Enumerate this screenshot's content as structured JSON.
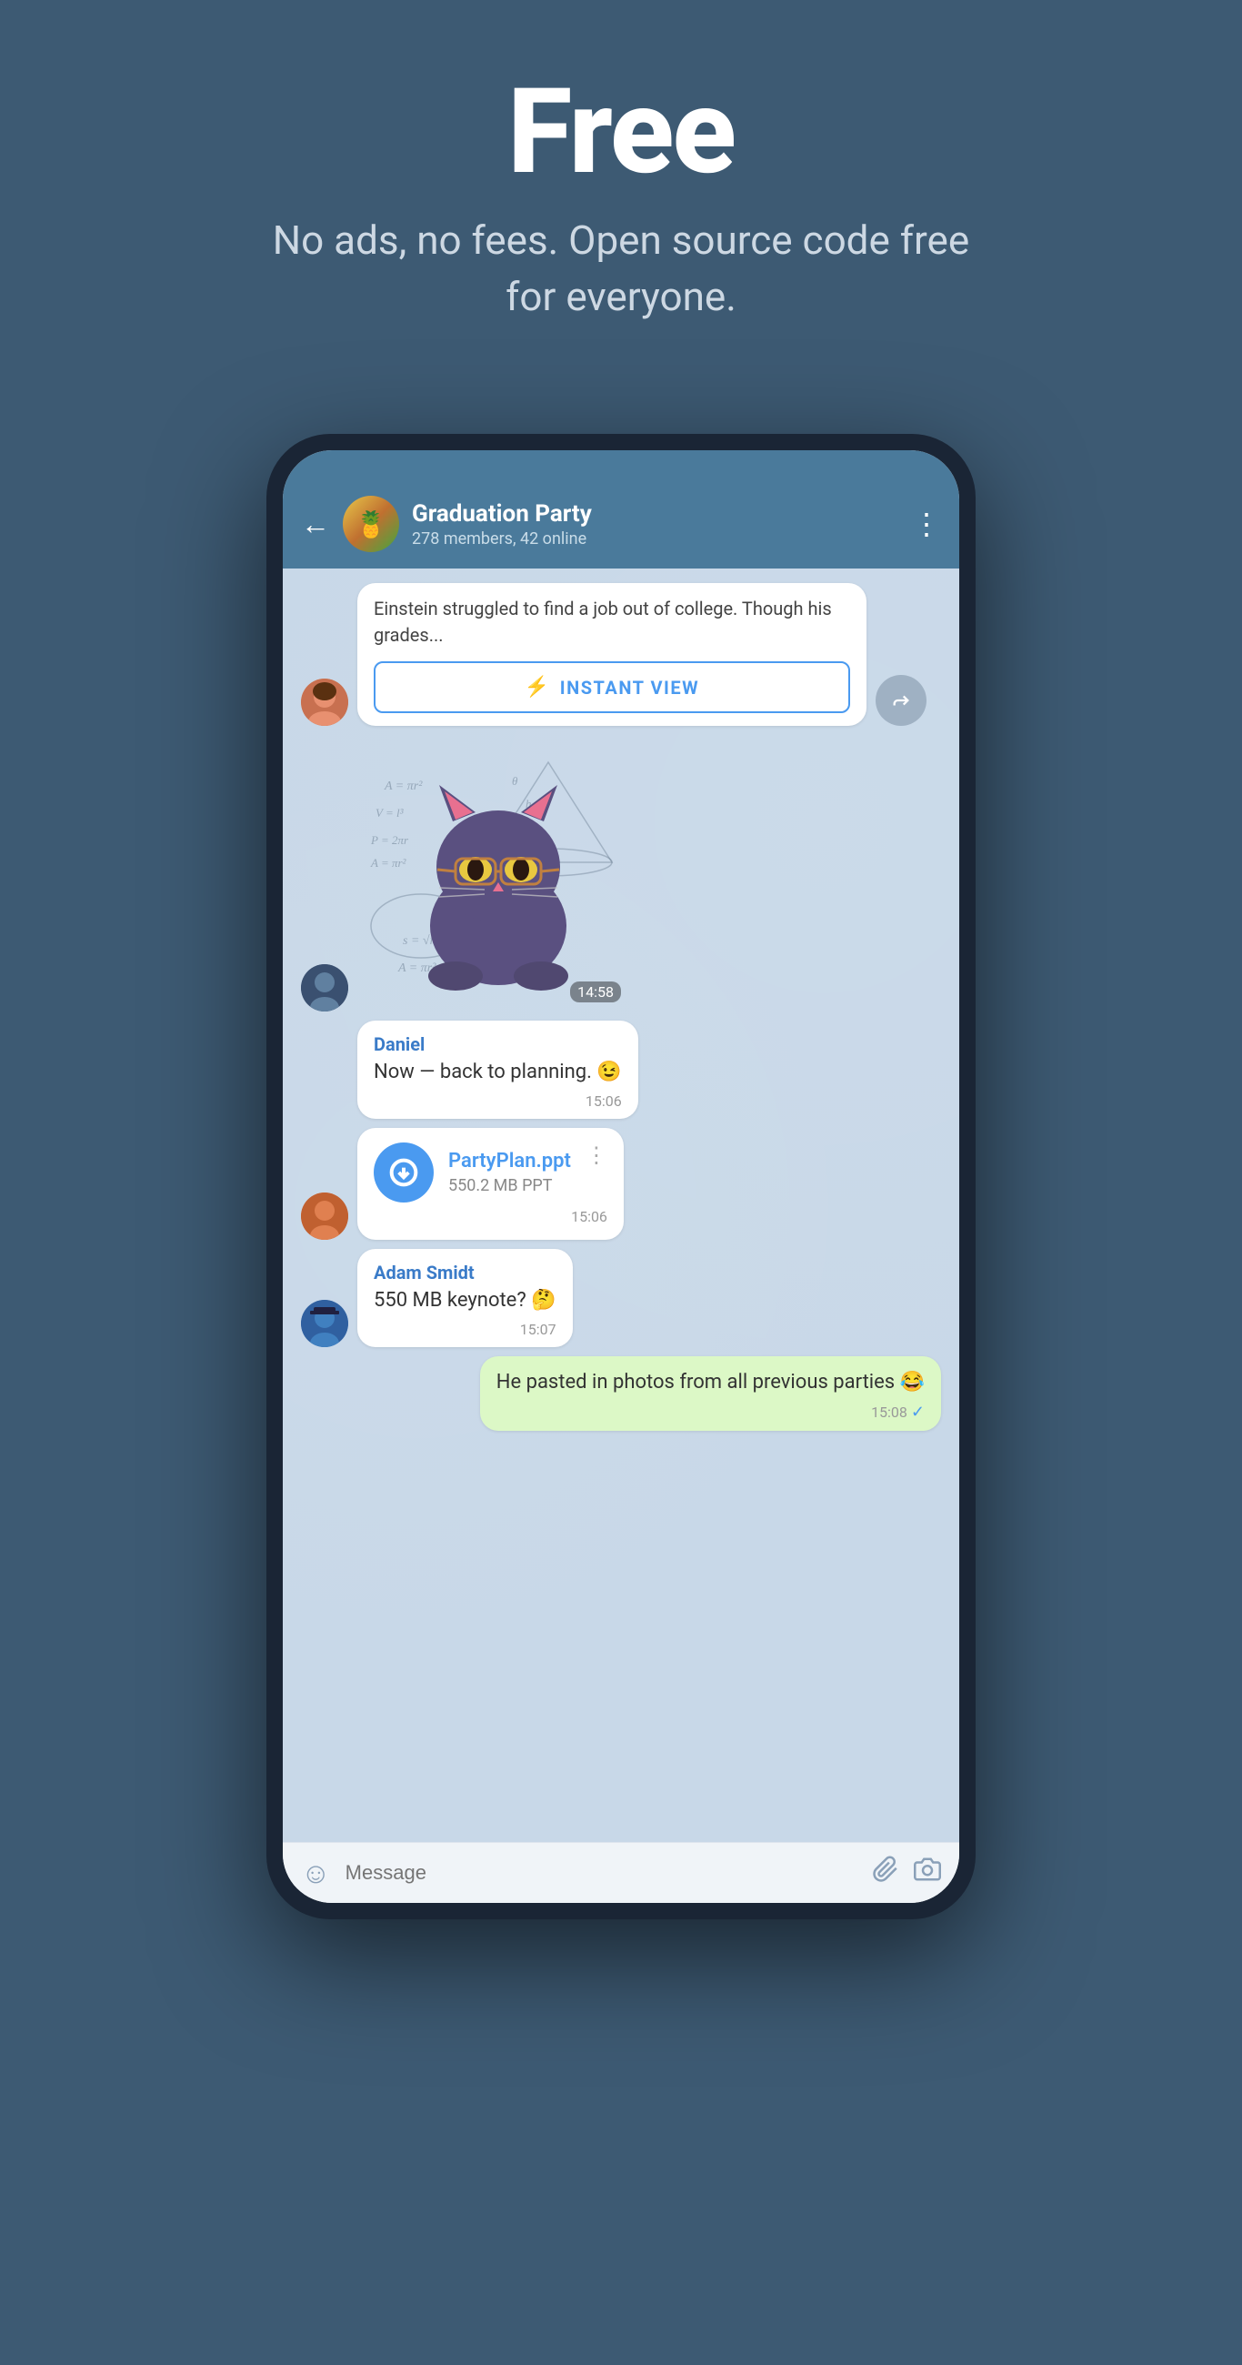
{
  "hero": {
    "title": "Free",
    "subtitle": "No ads, no fees. Open source code free for everyone."
  },
  "chat": {
    "group_name": "Graduation Party",
    "group_status": "278 members, 42 online",
    "back_label": "←",
    "menu_label": "⋮"
  },
  "messages": [
    {
      "id": "msg-link",
      "type": "link",
      "text": "Einstein struggled to find a job out of college. Though his grades...",
      "instant_view_label": "INSTANT VIEW"
    },
    {
      "id": "msg-sticker",
      "type": "sticker",
      "time": "14:58"
    },
    {
      "id": "msg-daniel",
      "type": "text",
      "sender": "Daniel",
      "text": "Now — back to planning. 😉",
      "time": "15:06"
    },
    {
      "id": "msg-file",
      "type": "file",
      "file_name": "PartyPlan.ppt",
      "file_size": "550.2 MB PPT",
      "time": "15:06"
    },
    {
      "id": "msg-adam",
      "type": "text",
      "sender": "Adam Smidt",
      "text": "550 MB keynote? 🤔",
      "time": "15:07"
    },
    {
      "id": "msg-outgoing",
      "type": "outgoing",
      "text": "He pasted in photos from all previous parties 😂",
      "time": "15:08"
    }
  ],
  "input": {
    "placeholder": "Message"
  }
}
